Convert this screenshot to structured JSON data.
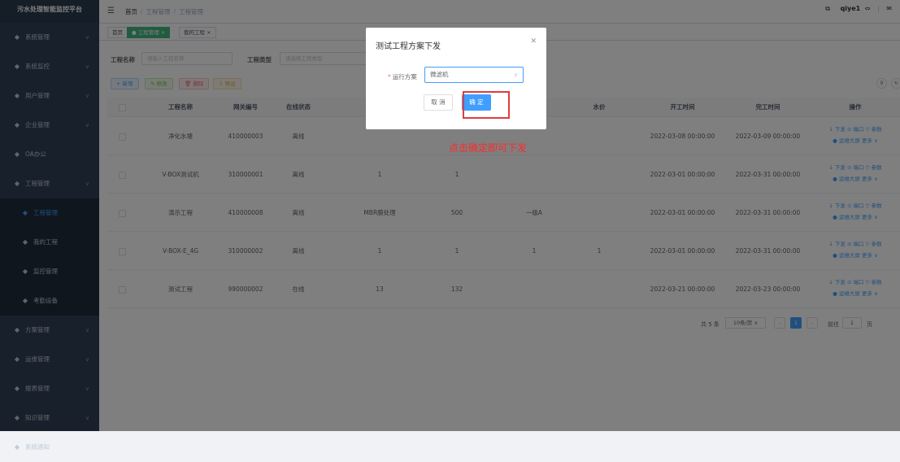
{
  "app": {
    "title": "污水处理智能监控平台"
  },
  "sidebar": {
    "items": [
      {
        "label": "系统管理",
        "icon": "gear-icon"
      },
      {
        "label": "系统监控",
        "icon": "monitor-icon"
      },
      {
        "label": "用户管理",
        "icon": "user-icon"
      },
      {
        "label": "企业管理",
        "icon": "building-icon"
      },
      {
        "label": "OA办公",
        "icon": "document-icon"
      },
      {
        "label": "工程管理",
        "icon": "project-icon"
      }
    ],
    "subitems": [
      {
        "label": "工程管理",
        "icon": "link-icon"
      },
      {
        "label": "我的工程",
        "icon": "grid-icon"
      },
      {
        "label": "监控管理",
        "icon": "eye-icon"
      },
      {
        "label": "考勤设备",
        "icon": "device-icon"
      }
    ],
    "items2": [
      {
        "label": "方案管理",
        "icon": "scheme-icon"
      },
      {
        "label": "运维管理",
        "icon": "wrench-icon"
      },
      {
        "label": "报表管理",
        "icon": "report-icon"
      },
      {
        "label": "知识管理",
        "icon": "book-icon"
      },
      {
        "label": "系统通知",
        "icon": "bell-icon"
      }
    ]
  },
  "header": {
    "breadcrumb": [
      "首页",
      "工程管理",
      "工程管理"
    ],
    "user": "qiye1"
  },
  "tags": [
    "首页",
    "工程管理",
    "我的工程"
  ],
  "filters": {
    "name_label": "工程名称",
    "name_placeholder": "请输入工程名称",
    "type_label": "工程类型",
    "type_placeholder": "请选择工程类型"
  },
  "toolbar": {
    "add": "+ 新增",
    "edit": "✎ 修改",
    "delete": "🗑 删除",
    "export": "⇩ 导出"
  },
  "table": {
    "headers": [
      "工程名称",
      "网关编号",
      "在线状态",
      "水价",
      "开工时间",
      "完工时间",
      "操作"
    ],
    "rows": [
      {
        "name": "净化水塘",
        "gateway": "410000003",
        "status": "离线",
        "c4": "",
        "c5": "",
        "c6": "",
        "c7": "",
        "start": "2022-03-08 00:00:00",
        "end": "2022-03-09 00:00:00"
      },
      {
        "name": "V-BOX测试机",
        "gateway": "310000001",
        "status": "离线",
        "c4": "1",
        "c5": "1",
        "c6": "",
        "c7": "",
        "start": "2022-03-01 00:00:00",
        "end": "2022-03-31 00:00:00"
      },
      {
        "name": "演示工程",
        "gateway": "410000008",
        "status": "离线",
        "c4": "MBR膜处理",
        "c5": "500",
        "c6": "一级A",
        "c7": "",
        "start": "2022-03-01 00:00:00",
        "end": "2022-03-31 00:00:00"
      },
      {
        "name": "V-BOX-E_4G",
        "gateway": "310000002",
        "status": "离线",
        "c4": "1",
        "c5": "1",
        "c6": "1",
        "c7": "1",
        "start": "2022-03-01 00:00:00",
        "end": "2022-03-31 00:00:00"
      },
      {
        "name": "测试工程",
        "gateway": "990000002",
        "status": "在线",
        "c4": "13",
        "c5": "132",
        "c6": "",
        "c7": "",
        "start": "2022-03-21 00:00:00",
        "end": "2022-03-23 00:00:00"
      }
    ],
    "ops_line1": "↓ 下发  ⊙ 端口  ▽ 参数",
    "ops_line2": "● 运维大屏  更多 ∨"
  },
  "pagination": {
    "total": "共 5 条",
    "page_size": "10条/页",
    "current": "1",
    "goto_label": "前往",
    "goto_value": "1",
    "page_suffix": "页"
  },
  "dialog": {
    "title": "测试工程方案下发",
    "field_label": "运行方案",
    "field_value": "微滤机",
    "cancel": "取 消",
    "confirm": "确 定"
  },
  "annotation": "点击确定即可下发"
}
